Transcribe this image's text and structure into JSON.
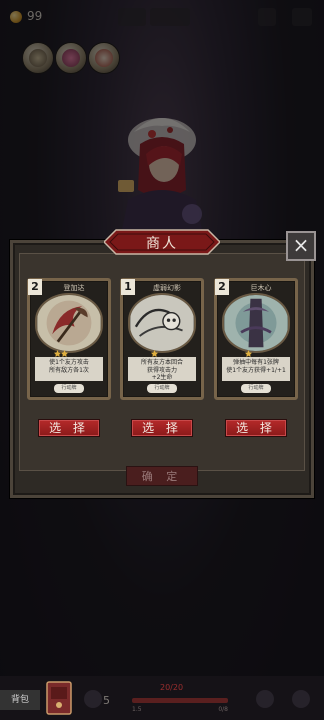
{
  "hud": {
    "coins": "99",
    "health": "20/20",
    "hp_sub_left": "1.5",
    "hp_sub_right": "0/8",
    "bag_label": "背包",
    "hand_count": "5",
    "status_icons": [
      "portrait-status-icon",
      "pink-book-status-icon",
      "feather-status-icon"
    ]
  },
  "merchant": {
    "title": "商人",
    "close_icon": "×",
    "confirm_label": "确 定",
    "cards": [
      {
        "name": "登加达",
        "cost": "2",
        "description_line1": "使1个友方攻击",
        "description_line2": "所有敌方各1次",
        "type": "行动牌",
        "select_label": "选 择",
        "art": "axe-art-icon"
      },
      {
        "name": "虚弱幻影",
        "cost": "1",
        "description_line1": "所有友方本回合",
        "description_line2": "获得攻击力",
        "description_line3": "+2生命",
        "type": "行动牌",
        "select_label": "选 择",
        "art": "wind-skull-art-icon"
      },
      {
        "name": "巨木心",
        "cost": "2",
        "description_line1": "弹抽中每有1张牌",
        "description_line2": "使1个友方获得+1/+1",
        "type": "行动牌",
        "select_label": "选 择",
        "art": "tree-art-icon"
      }
    ]
  },
  "colors": {
    "select_red": "#b52a2a",
    "banner_red": "#7a1818",
    "card_frame": "#77644a",
    "gold": "#d39a2a"
  }
}
